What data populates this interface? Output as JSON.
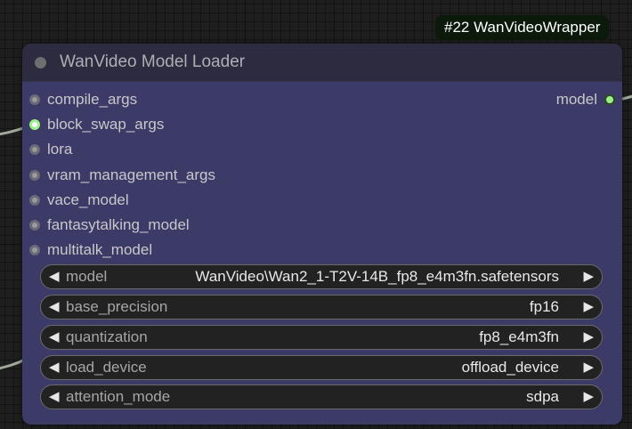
{
  "badge": {
    "text": "#22 WanVideoWrapper"
  },
  "node": {
    "title": "WanVideo Model Loader",
    "output": {
      "label": "model",
      "connected": true
    },
    "inputs": [
      {
        "label": "compile_args",
        "connected": false
      },
      {
        "label": "block_swap_args",
        "connected": true
      },
      {
        "label": "lora",
        "connected": false
      },
      {
        "label": "vram_management_args",
        "connected": false
      },
      {
        "label": "vace_model",
        "connected": false
      },
      {
        "label": "fantasytalking_model",
        "connected": false
      },
      {
        "label": "multitalk_model",
        "connected": false
      }
    ],
    "widgets": [
      {
        "label": "model",
        "value": "WanVideo\\Wan2_1-T2V-14B_fp8_e4m3fn.safetensors"
      },
      {
        "label": "base_precision",
        "value": "fp16"
      },
      {
        "label": "quantization",
        "value": "fp8_e4m3fn"
      },
      {
        "label": "load_device",
        "value": "offload_device"
      },
      {
        "label": "attention_mode",
        "value": "sdpa"
      }
    ]
  },
  "icons": {
    "arrow_left": "◀",
    "arrow_right": "▶"
  },
  "colors": {
    "node_body": "#3c3a66",
    "node_title_bar": "#2c2b3f",
    "link": "#9fa89a",
    "connected_slot": "#9cf08a",
    "canvas": "#1e1e1e"
  }
}
